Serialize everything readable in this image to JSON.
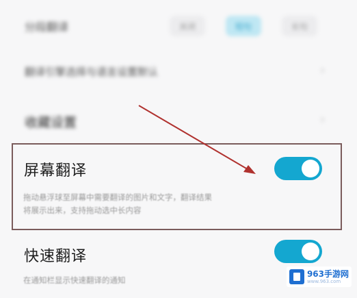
{
  "rows": {
    "row1": {
      "label": "分段翻译",
      "options": [
        "关闭",
        "短句",
        "长句"
      ],
      "active_index": 1
    },
    "row2": {
      "label": "翻译引擎选择与语言设置默认"
    },
    "row3": {
      "label": "收藏设置"
    }
  },
  "screen_translate": {
    "title": "屏幕翻译",
    "enabled": true,
    "description_line1": "拖动悬浮球至屏幕中需要翻译的图片和文字，翻译结果",
    "description_line2": "将展示出来，支持拖动选中长内容"
  },
  "quick_translate": {
    "title": "快速翻译",
    "enabled": true,
    "description": "在通知栏显示快速翻译的通知"
  },
  "watermark": {
    "main": "963手游网",
    "sub": "www.963.com"
  },
  "colors": {
    "toggle_on": "#14a7d0",
    "highlight_border": "#7a5b5b",
    "arrow": "#b0322f"
  }
}
